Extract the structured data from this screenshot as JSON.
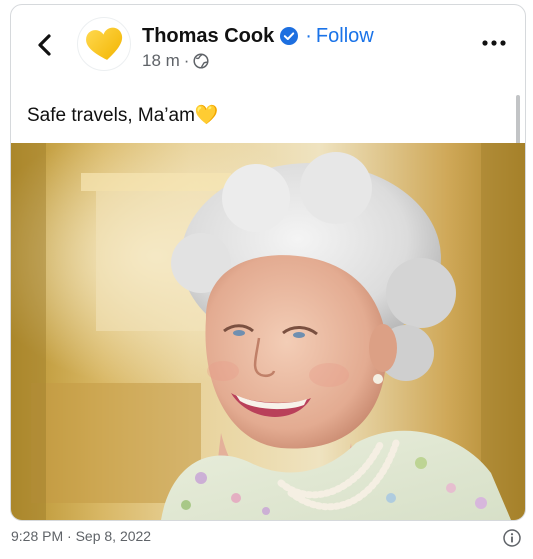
{
  "post": {
    "author": "Thomas Cook",
    "follow_label": "Follow",
    "separator": "·",
    "time_ago": "18 m",
    "meta_separator": "·",
    "text": "Safe travels, Ma’am💛"
  },
  "footer": {
    "timestamp": "9:28 PM · Sep 8, 2022"
  },
  "icons": {
    "back": "back-arrow-icon",
    "verified": "verified-badge-icon",
    "globe": "globe-icon",
    "more": "more-options-icon",
    "info": "info-icon",
    "logo": "heart-logo-icon"
  },
  "colors": {
    "link": "#1a73e8",
    "verified": "#1d6fe0",
    "logo_yellow": "#f7c325",
    "text": "#111111",
    "muted": "#5f6368"
  }
}
